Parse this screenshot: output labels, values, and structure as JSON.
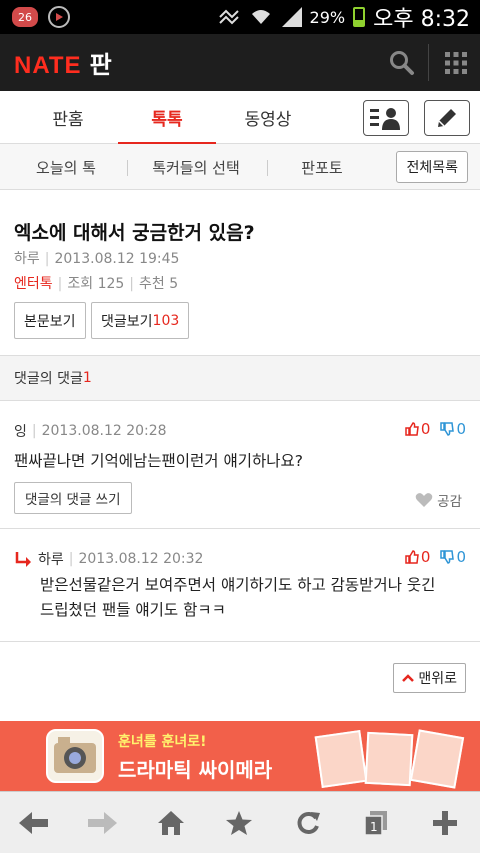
{
  "status_bar": {
    "notification_count": "26",
    "battery_percent": "29%",
    "time": "오후 8:32"
  },
  "app": {
    "logo_nate": "NATE",
    "logo_pan": "판"
  },
  "tabs": [
    "판홈",
    "톡톡",
    "동영상"
  ],
  "active_tab": "톡톡",
  "subnav": {
    "items": [
      "오늘의 톡",
      "톡커들의 선택",
      "판포토"
    ],
    "all_button": "전체목록"
  },
  "article": {
    "title": "엑소에 대해서 궁금한거 있음?",
    "author": "하루",
    "date": "2013.08.12 19:45",
    "category": "엔터톡",
    "views": "조회 125",
    "recommends": "추천 5",
    "view_body_button": "본문보기",
    "view_comments_label": "댓글보기",
    "comment_count": "103"
  },
  "reply_section": {
    "label": "댓글의 댓글",
    "count": "1"
  },
  "comments": [
    {
      "author": "잉",
      "date": "2013.08.12 20:28",
      "up": "0",
      "down": "0",
      "body": "팬싸끝나면 기억에남는팬이런거 얘기하나요?",
      "reply_button": "댓글의 댓글 쓰기",
      "like_label": "공감"
    },
    {
      "author": "하루",
      "date": "2013.08.12 20:32",
      "up": "0",
      "down": "0",
      "body_line1": "받은선물같은거 보여주면서 얘기하기도 하고 감동받거나 웃긴",
      "body_line2": "드립쳤던 팬들 얘기도 함ㅋㅋ"
    }
  ],
  "top_button": "맨위로",
  "banner": {
    "subtitle": "훈녀를 훈녀로!",
    "title": "드라마틱 싸이메라"
  },
  "colors": {
    "brand_red": "#e6271e",
    "down_blue": "#2f95d6",
    "banner_bg": "#f2604a"
  }
}
